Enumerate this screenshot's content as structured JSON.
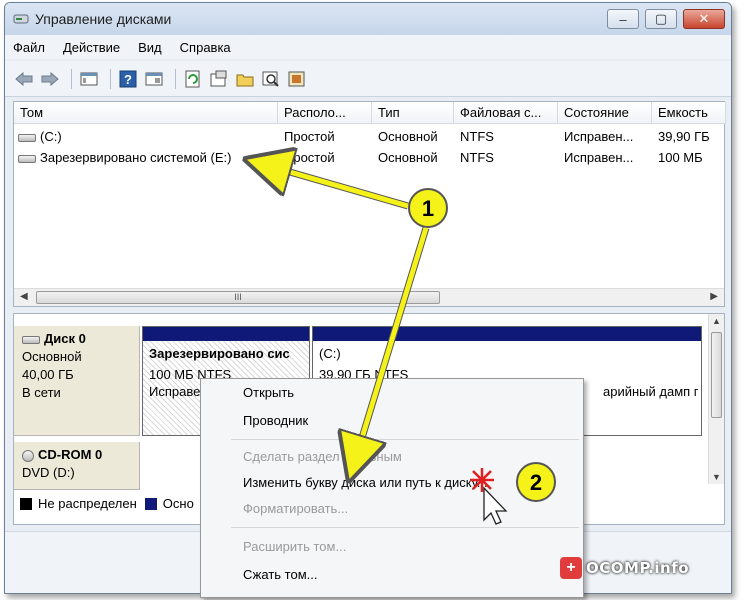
{
  "window": {
    "title": "Управление дисками",
    "controls": [
      "–",
      "▢",
      "✕"
    ]
  },
  "menu": [
    "Файл",
    "Действие",
    "Вид",
    "Справка"
  ],
  "toolbar_icons": [
    "back-arrow-icon",
    "forward-arrow-icon",
    "console-icon",
    "help-icon",
    "properties-icon",
    "refresh-icon",
    "rescan-icon",
    "open-icon",
    "search-icon",
    "settings-icon"
  ],
  "volumes": {
    "columns": [
      "Том",
      "Располо...",
      "Тип",
      "Файловая с...",
      "Состояние",
      "Емкость"
    ],
    "rows": [
      [
        "(C:)",
        "Простой",
        "Основной",
        "NTFS",
        "Исправен...",
        "39,90 ГБ"
      ],
      [
        "Зарезервировано системой (E:)",
        "Простой",
        "Основной",
        "NTFS",
        "Исправен...",
        "100 МБ"
      ]
    ],
    "scroll_thumb": "III"
  },
  "disks": [
    {
      "name": "Диск 0",
      "type": "Основной",
      "size": "40,00 ГБ",
      "status": "В сети"
    },
    {
      "name": "CD-ROM 0",
      "type": "DVD (D:)",
      "size": "",
      "status": ""
    }
  ],
  "partitions": [
    {
      "title": "Зарезервировано сис",
      "line2": "100 МБ NTFS",
      "line3": "Исправен"
    },
    {
      "title": "(C:)",
      "line2": "39,90 ГБ NTFS",
      "line3": "арийный дамп г"
    }
  ],
  "legend": [
    {
      "label": "Не распределен",
      "color": "#000000"
    },
    {
      "label": "Осно",
      "color": "#0f1a78"
    }
  ],
  "context_menu": {
    "items": [
      {
        "label": "Открыть",
        "disabled": false
      },
      {
        "label": "Проводник",
        "disabled": false
      },
      {
        "label": "Сделать раздел активным",
        "disabled": true
      },
      {
        "label": "Изменить букву диска или путь к диску...",
        "disabled": false
      },
      {
        "label": "Форматировать...",
        "disabled": true
      },
      {
        "label": "Расширить том...",
        "disabled": true
      },
      {
        "label": "Сжать том...",
        "disabled": false
      }
    ]
  },
  "annotations": {
    "callout1": "1",
    "callout2": "2",
    "arrow_color": "#f5f21a"
  },
  "watermark": {
    "text": "OCOMP.info",
    "badge": "+"
  }
}
